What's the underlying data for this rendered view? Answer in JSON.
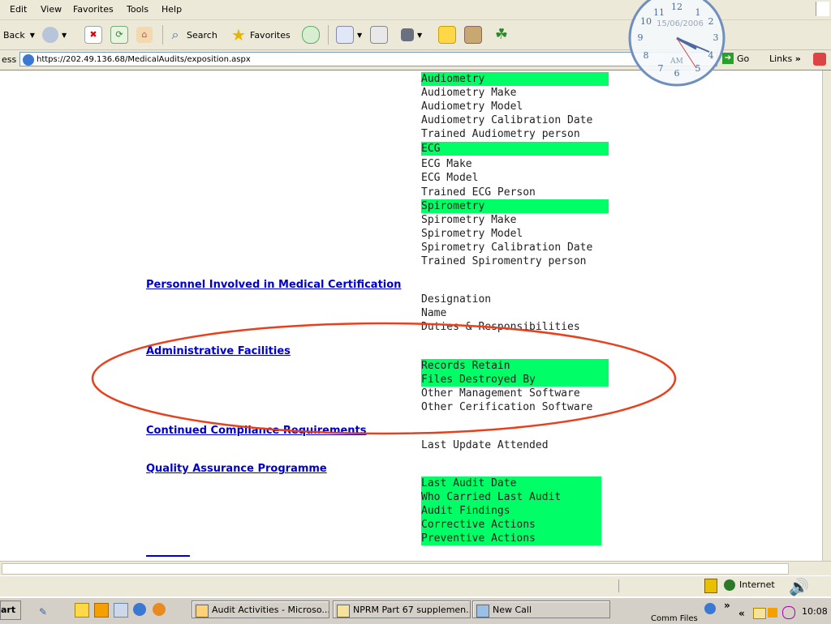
{
  "menu": {
    "items": [
      "Edit",
      "View",
      "Favorites",
      "Tools",
      "Help"
    ]
  },
  "toolbar": {
    "back_label": "Back",
    "search_label": "Search",
    "favorites_label": "Favorites"
  },
  "address": {
    "label": "ess",
    "url": "https://202.49.136.68/MedicalAudits/exposition.aspx",
    "go_label": "Go",
    "links_label": "Links"
  },
  "clock": {
    "date": "15/06/2006",
    "ampm": "AM",
    "numbers": [
      "12",
      "1",
      "2",
      "3",
      "4",
      "5",
      "6",
      "7",
      "8",
      "9",
      "10",
      "11"
    ]
  },
  "content": {
    "audiometry": [
      {
        "text": "Audiometry",
        "highlight": true
      },
      {
        "text": "Audiometry Make",
        "highlight": false
      },
      {
        "text": "Audiometry Model",
        "highlight": false
      },
      {
        "text": "Audiometry Calibration Date",
        "highlight": false
      },
      {
        "text": "Trained Audiometry person",
        "highlight": false
      }
    ],
    "ecg": [
      {
        "text": "ECG",
        "highlight": true
      },
      {
        "text": "ECG Make",
        "highlight": false
      },
      {
        "text": "ECG Model",
        "highlight": false
      },
      {
        "text": "Trained ECG Person",
        "highlight": false
      }
    ],
    "spirometry": [
      {
        "text": "Spirometry",
        "highlight": true
      },
      {
        "text": "Spirometry Make",
        "highlight": false
      },
      {
        "text": "Spirometry Model",
        "highlight": false
      },
      {
        "text": "Spirometry Calibration Date",
        "highlight": false
      },
      {
        "text": "Trained Spiromentry person",
        "highlight": false
      }
    ],
    "personnel": {
      "title": "Personnel Involved in Medical Certification",
      "items": [
        "Designation",
        "Name",
        "Duties & Responsibilities"
      ]
    },
    "administrative": {
      "title": "Administrative Facilities",
      "items": [
        {
          "text": "Records Retain",
          "highlight": true
        },
        {
          "text": "Files Destroyed By",
          "highlight": true
        },
        {
          "text": "Other Management Software",
          "highlight": false
        },
        {
          "text": "Other Cerification Software",
          "highlight": false
        }
      ]
    },
    "compliance": {
      "title": "Continued Compliance Requirements",
      "items": [
        "Last Update Attended"
      ]
    },
    "quality": {
      "title": "Quality Assurance Programme",
      "items": [
        "Last Audit Date",
        "Who Carried Last Audit",
        "Audit Findings",
        "Corrective Actions",
        "Preventive Actions"
      ]
    },
    "highlight_color": "#00ff66",
    "annotation_color": "#e8401c"
  },
  "status": {
    "zone": "Internet"
  },
  "taskbar": {
    "start_label": "art",
    "buttons": [
      "Audit Activities - Microso...",
      "NPRM Part 67 supplemen...",
      "New Call"
    ],
    "tray_label": "Comm Files",
    "time": "10:08"
  }
}
